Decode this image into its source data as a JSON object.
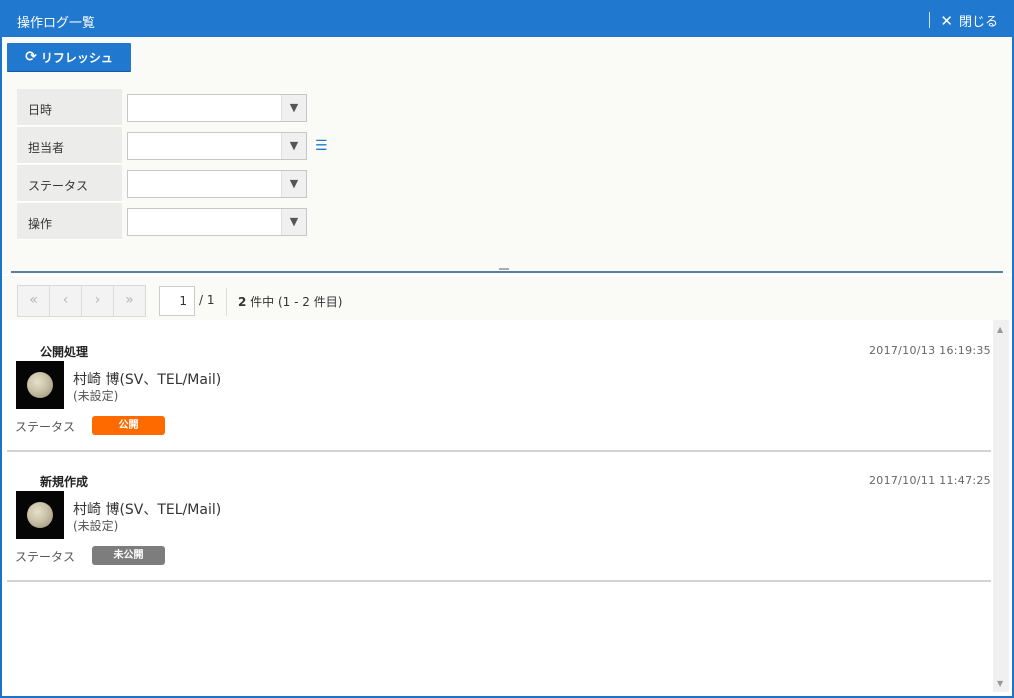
{
  "window": {
    "title": "操作ログ一覧",
    "close_label": "閉じる"
  },
  "toolbar": {
    "refresh_label": "リフレッシュ"
  },
  "filters": [
    {
      "label": "日時",
      "value": "",
      "has_list_icon": false
    },
    {
      "label": "担当者",
      "value": "",
      "has_list_icon": true
    },
    {
      "label": "ステータス",
      "value": "",
      "has_list_icon": false
    },
    {
      "label": "操作",
      "value": "",
      "has_list_icon": false
    }
  ],
  "pager": {
    "first_icon": "«",
    "prev_icon": "‹",
    "next_icon": "›",
    "last_icon": "»",
    "current_page": "1",
    "total_pages": "/ 1",
    "count_bold": "2",
    "count_text": " 件中 (1 - 2 件目)"
  },
  "logs": [
    {
      "operation": "公開処理",
      "timestamp": "2017/10/13 16:19:35",
      "user_name": "村崎 博(SV、TEL/Mail)",
      "user_sub": "(未設定)",
      "status_label": "ステータス",
      "badge_label": "公開",
      "badge_color": "#ff6a00"
    },
    {
      "operation": "新規作成",
      "timestamp": "2017/10/11 11:47:25",
      "user_name": "村崎 博(SV、TEL/Mail)",
      "user_sub": "(未設定)",
      "status_label": "ステータス",
      "badge_label": "未公開",
      "badge_color": "#7d7d7d"
    }
  ],
  "colors": {
    "accent": "#2178cf"
  }
}
